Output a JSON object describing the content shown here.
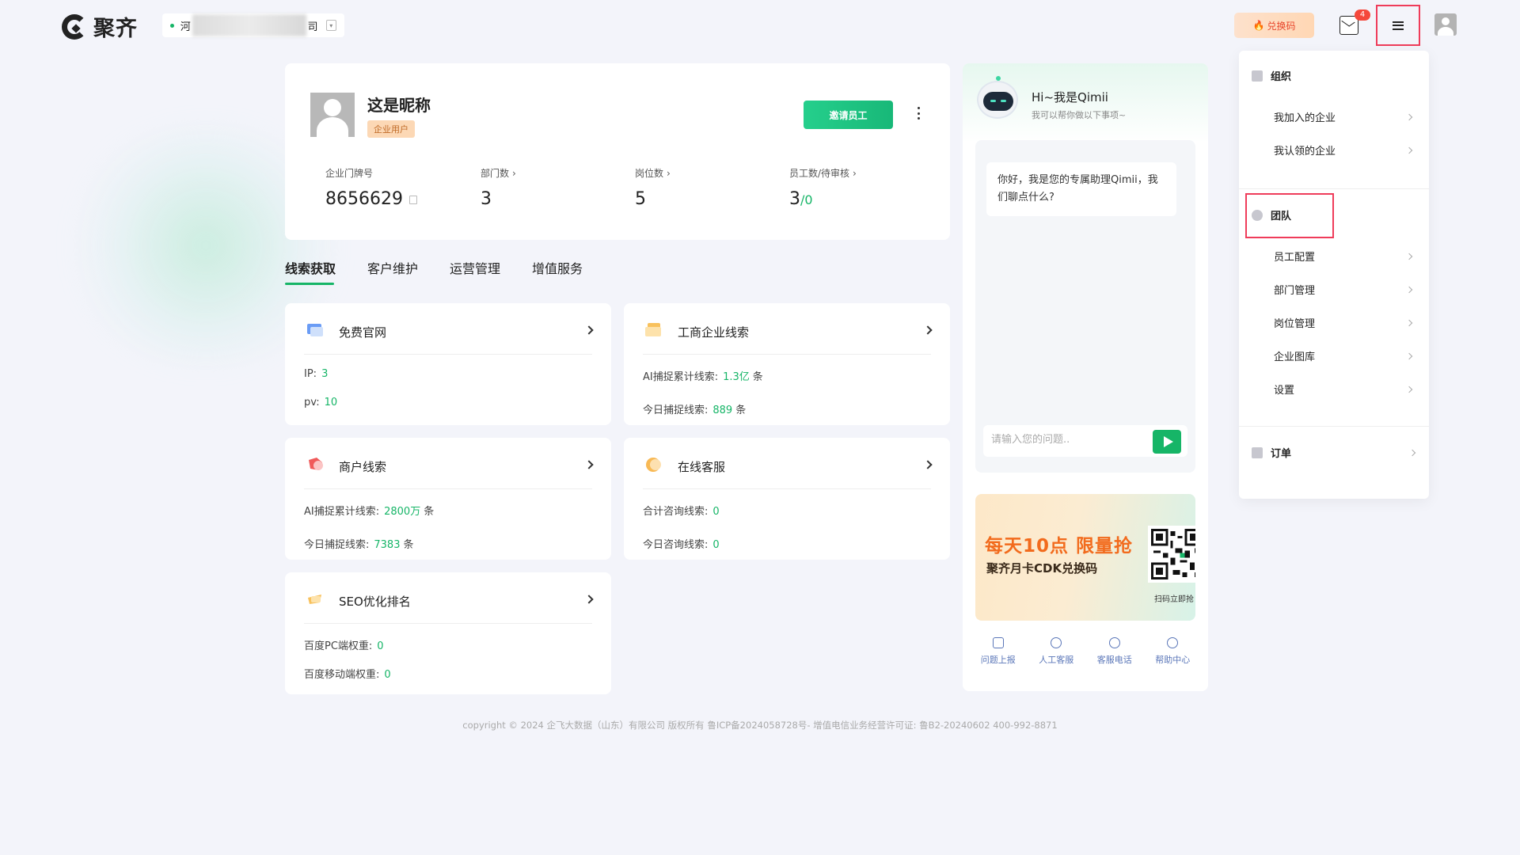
{
  "header": {
    "logo_text": "聚齐",
    "company_prefix": "河",
    "company_suffix": "司",
    "redeem_label": "兑换码",
    "mail_badge": "4"
  },
  "profile": {
    "name": "这是昵称",
    "tag": "企业用户",
    "invite_label": "邀请员工",
    "stats": [
      {
        "label": "企业门牌号",
        "value": "8656629"
      },
      {
        "label": "部门数",
        "value": "3"
      },
      {
        "label": "岗位数",
        "value": "5"
      },
      {
        "label": "员工数/待审核",
        "value": "3",
        "value_extra": "/0"
      }
    ]
  },
  "tabs": [
    "线索获取",
    "客户维护",
    "运营管理",
    "增值服务"
  ],
  "features": [
    {
      "title": "免费官网",
      "rows": [
        {
          "label": "IP:",
          "value": "3",
          "unit": ""
        },
        {
          "label": "pv:",
          "value": "10",
          "unit": ""
        }
      ]
    },
    {
      "title": "工商企业线索",
      "rows": [
        {
          "label": "AI捕捉累计线索:",
          "value": "1.3亿",
          "unit": "条"
        },
        {
          "label": "今日捕捉线索:",
          "value": "889",
          "unit": "条"
        }
      ]
    },
    {
      "title": "商户线索",
      "rows": [
        {
          "label": "AI捕捉累计线索:",
          "value": "2800万",
          "unit": "条"
        },
        {
          "label": "今日捕捉线索:",
          "value": "7383",
          "unit": "条"
        }
      ]
    },
    {
      "title": "在线客服",
      "rows": [
        {
          "label": "合计咨询线索:",
          "value": "0",
          "unit": ""
        },
        {
          "label": "今日咨询线索:",
          "value": "0",
          "unit": ""
        }
      ]
    },
    {
      "title": "SEO优化排名",
      "rows": [
        {
          "label": "百度PC端权重:",
          "value": "0",
          "unit": ""
        },
        {
          "label": "百度移动端权重:",
          "value": "0",
          "unit": ""
        }
      ]
    }
  ],
  "assistant": {
    "title": "Hi~我是Qimii",
    "subtitle": "我可以帮你做以下事项~",
    "bubble": "你好，我是您的专属助理Qimii，我们聊点什么?",
    "placeholder": "请输入您的问题..",
    "promo_line1": "每天10点 限量抢",
    "promo_line2": "聚齐月卡CDK兑换码",
    "promo_scan": "扫码立即抢",
    "help": [
      "问题上报",
      "人工客服",
      "客服电话",
      "帮助中心"
    ]
  },
  "menu": {
    "org_title": "组织",
    "org_items": [
      "我加入的企业",
      "我认领的企业"
    ],
    "team_title": "团队",
    "team_items": [
      "员工配置",
      "部门管理",
      "岗位管理",
      "企业图库",
      "设置"
    ],
    "order_title": "订单"
  },
  "footer": "copyright © 2024 企飞大数据（山东）有限公司 版权所有   鲁ICP备2024058728号-   增值电信业务经营许可证: 鲁B2-20240602  400-992-8871",
  "colors": {
    "accent": "#16b567",
    "highlight": "#ef3c5a"
  }
}
